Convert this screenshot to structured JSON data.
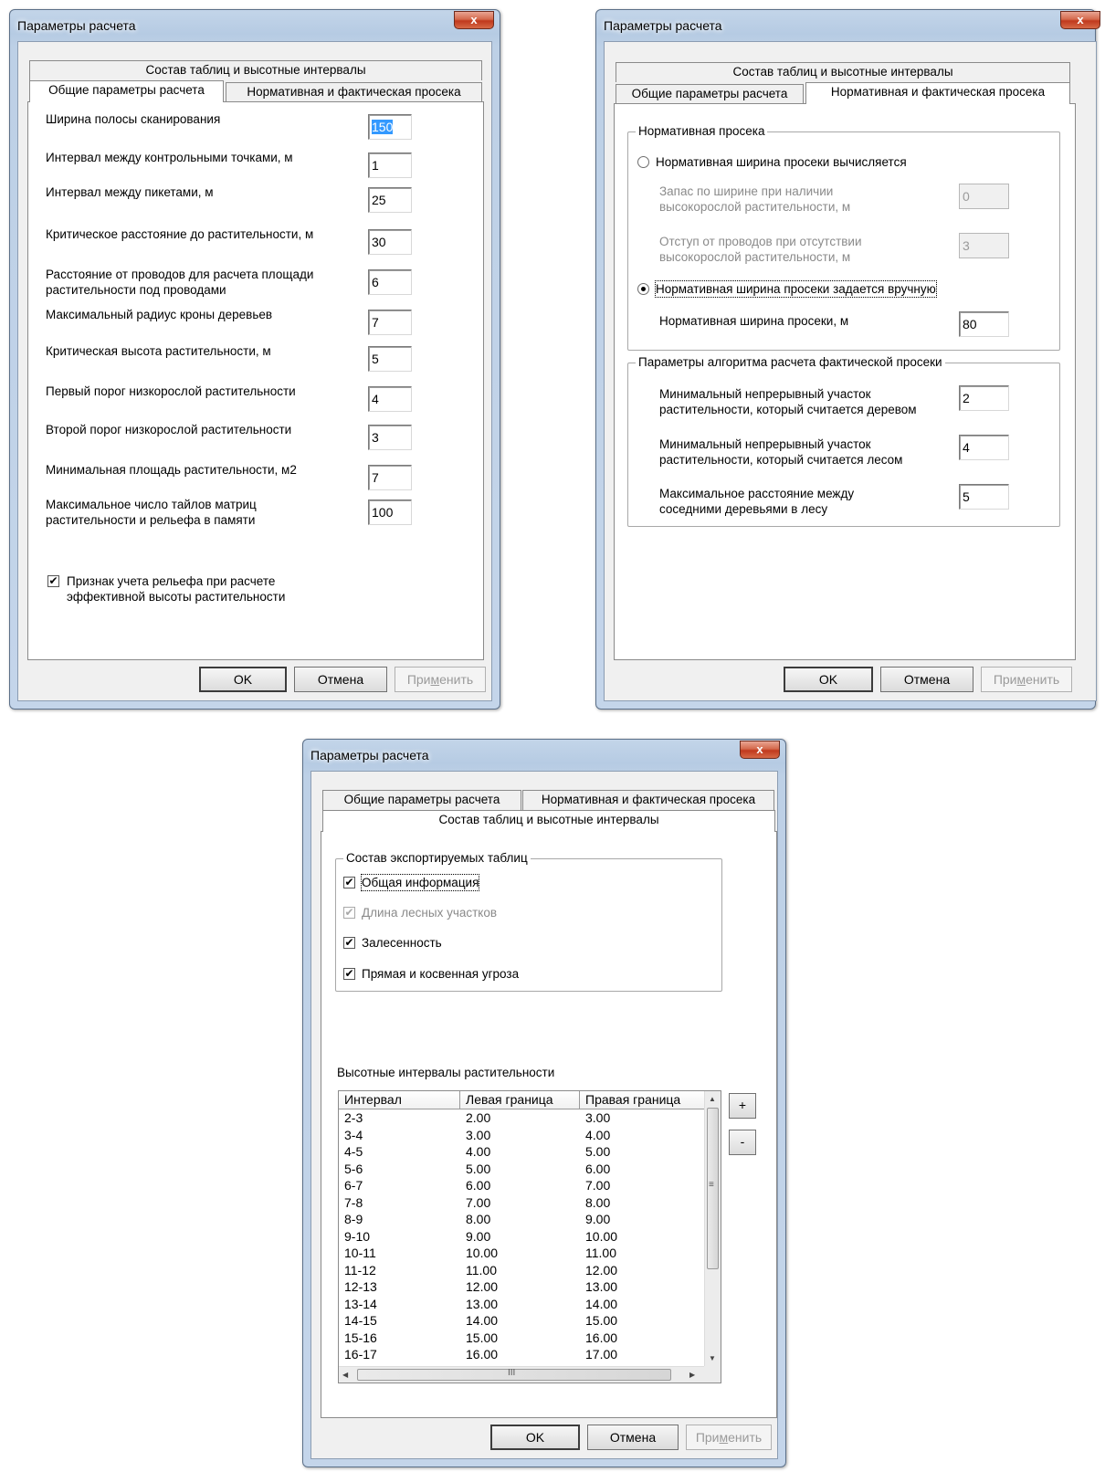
{
  "dialog_title": "Параметры расчета",
  "close_glyph": "x",
  "tabs": {
    "general": "Общие параметры расчета",
    "clearing": "Нормативная и фактическая просека",
    "tables": "Состав таблиц и высотные интервалы"
  },
  "buttons": {
    "ok": "OK",
    "cancel": "Отмена",
    "apply_a": "При",
    "apply_u": "м",
    "apply_b": "енить"
  },
  "general": {
    "fields": [
      {
        "label": "Ширина полосы сканирования",
        "value": "150"
      },
      {
        "label": "Интервал между контрольными точками, м",
        "value": "1"
      },
      {
        "label": "Интервал между пикетами, м",
        "value": "25"
      },
      {
        "label": "Критическое расстояние до растительности, м",
        "value": "30"
      },
      {
        "label": "Расстояние от проводов для расчета площади",
        "label2": "растительности под проводами",
        "value": "6"
      },
      {
        "label": "Максимальный радиус кроны деревьев",
        "value": "7"
      },
      {
        "label": "Критическая высота растительности, м",
        "value": "5"
      },
      {
        "label": "Первый порог низкорослой растительности",
        "value": "4"
      },
      {
        "label": "Второй порог низкорослой растительности",
        "value": "3"
      },
      {
        "label": "Минимальная площадь растительности, м2",
        "value": "7"
      },
      {
        "label": "Максимальное число тайлов матриц",
        "label2": "растительности и рельефа в памяти",
        "value": "100"
      }
    ],
    "relief_check": {
      "checked": true,
      "label": "Признак учета рельефа при расчете",
      "label2": "эффективной высоты растительности"
    }
  },
  "clearing": {
    "norm_group": "Нормативная просека",
    "radio_computed": {
      "selected": false,
      "label": "Нормативная ширина просеки вычисляется"
    },
    "margin": {
      "label": "Запас по ширине при наличии",
      "label2": "высокорослой растительности, м",
      "value": "0"
    },
    "offset": {
      "label": "Отступ от проводов при отсутствии",
      "label2": "высокорослой растительности, м",
      "value": "3"
    },
    "radio_manual": {
      "selected": true,
      "label": "Нормативная ширина просеки задается вручную"
    },
    "width": {
      "label": "Нормативная ширина просеки, м",
      "value": "80"
    },
    "algo_group": "Параметры алгоритма расчета фактической просеки",
    "tree": {
      "label": "Минимальный непрерывный участок",
      "label2": "растительности, который считается деревом",
      "value": "2"
    },
    "forest": {
      "label": "Минимальный непрерывный участок",
      "label2": "растительности, который считается лесом",
      "value": "4"
    },
    "distance": {
      "label": "Максимальное расстояние между",
      "label2": "соседними деревьями в лесу",
      "value": "5"
    }
  },
  "tables": {
    "export_group": "Состав экспортируемых таблиц",
    "checks": [
      {
        "label": "Общая информация",
        "checked": true,
        "disabled": false
      },
      {
        "label": "Длина лесных участков",
        "checked": true,
        "disabled": true
      },
      {
        "label": "Залесенность",
        "checked": true,
        "disabled": false
      },
      {
        "label": "Прямая и косвенная угроза",
        "checked": true,
        "disabled": false
      }
    ],
    "intervals_label": "Высотные интервалы растительности",
    "columns": [
      "Интервал",
      "Левая граница",
      "Правая граница"
    ],
    "rows": [
      [
        "2-3",
        "2.00",
        "3.00"
      ],
      [
        "3-4",
        "3.00",
        "4.00"
      ],
      [
        "4-5",
        "4.00",
        "5.00"
      ],
      [
        "5-6",
        "5.00",
        "6.00"
      ],
      [
        "6-7",
        "6.00",
        "7.00"
      ],
      [
        "7-8",
        "7.00",
        "8.00"
      ],
      [
        "8-9",
        "8.00",
        "9.00"
      ],
      [
        "9-10",
        "9.00",
        "10.00"
      ],
      [
        "10-11",
        "10.00",
        "11.00"
      ],
      [
        "11-12",
        "11.00",
        "12.00"
      ],
      [
        "12-13",
        "12.00",
        "13.00"
      ],
      [
        "13-14",
        "13.00",
        "14.00"
      ],
      [
        "14-15",
        "14.00",
        "15.00"
      ],
      [
        "15-16",
        "15.00",
        "16.00"
      ],
      [
        "16-17",
        "16.00",
        "17.00"
      ]
    ],
    "add_label": "+",
    "remove_label": "-"
  },
  "icons": {
    "check": "✔",
    "up": "▲",
    "down": "▼",
    "left": "◀",
    "right": "▶",
    "grip": "≡",
    "hgrip": "III"
  }
}
